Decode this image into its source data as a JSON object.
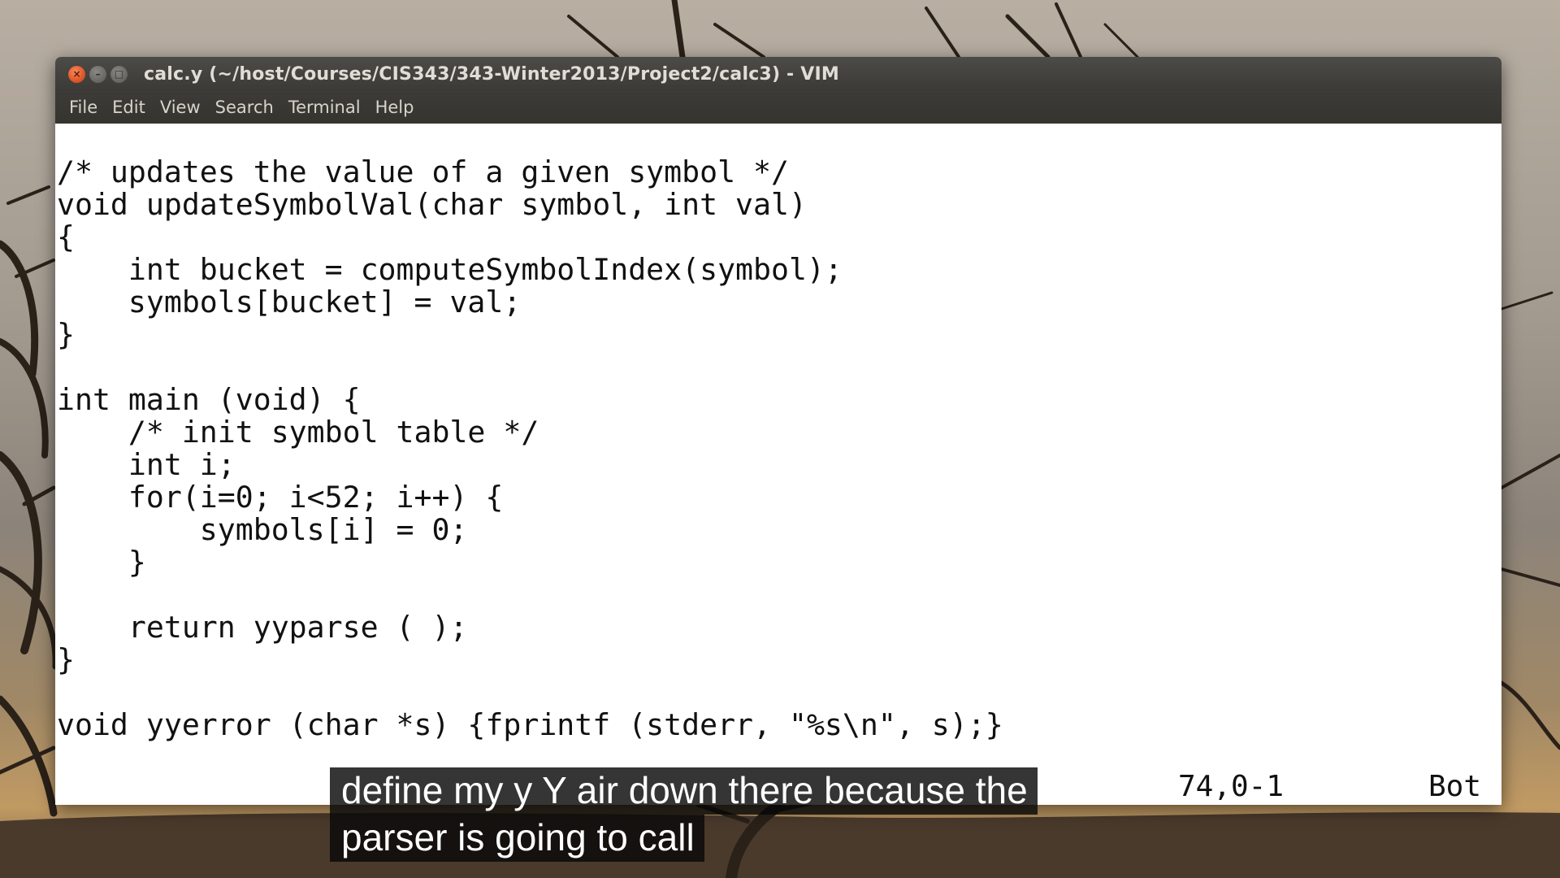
{
  "window": {
    "title": "calc.y (~/host/Courses/CIS343/343-Winter2013/Project2/calc3) - VIM",
    "buttons": {
      "close": "×",
      "minimize": "–",
      "maximize": "□"
    }
  },
  "menu": [
    "File",
    "Edit",
    "View",
    "Search",
    "Terminal",
    "Help"
  ],
  "editor": {
    "lines": [
      "/* updates the value of a given symbol */",
      "void updateSymbolVal(char symbol, int val)",
      "{",
      "    int bucket = computeSymbolIndex(symbol);",
      "    symbols[bucket] = val;",
      "}",
      "",
      "int main (void) {",
      "    /* init symbol table */",
      "    int i;",
      "    for(i=0; i<52; i++) {",
      "        symbols[i] = 0;",
      "    }",
      "",
      "    return yyparse ( );",
      "}",
      "",
      "void yyerror (char *s) {fprintf (stderr, \"%s\\n\", s);}"
    ],
    "status": {
      "position": "74,0-1",
      "scroll": "Bot"
    }
  },
  "caption": {
    "lines": [
      "define my y Y air down there because the",
      "parser is going to call"
    ]
  },
  "colors": {
    "titlebar": "#3b3a37",
    "close_button": "#e25a2b",
    "editor_background": "#ffffff",
    "code_text": "#111111"
  }
}
